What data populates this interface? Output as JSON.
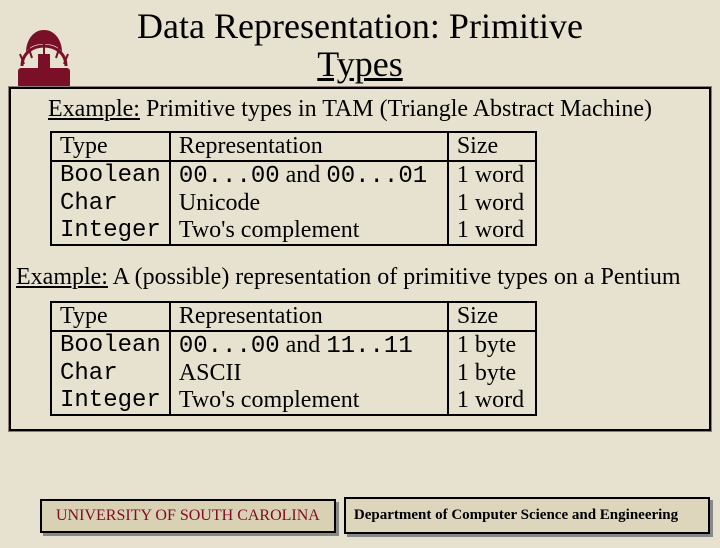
{
  "title_line1": "Data Representation: Primitive",
  "title_line2": "Types",
  "example1_label": "Example:",
  "example1_text": " Primitive types in TAM (Triangle Abstract Machine)",
  "table1": {
    "headers": [
      "Type",
      "Representation",
      "Size"
    ],
    "rows": [
      {
        "type": "Boolean",
        "repr_parts": [
          "00...00",
          " and ",
          "00...01"
        ],
        "size": "1 word"
      },
      {
        "type": "Char",
        "repr_parts": [
          "Unicode"
        ],
        "size": "1 word"
      },
      {
        "type": "Integer",
        "repr_parts": [
          "Two's complement"
        ],
        "size": "1 word"
      }
    ]
  },
  "example2_label": "Example:",
  "example2_text": " A (possible) representation of primitive types on a Pentium",
  "table2": {
    "headers": [
      "Type",
      "Representation",
      "Size"
    ],
    "rows": [
      {
        "type": "Boolean",
        "repr_parts": [
          "00...00",
          " and ",
          "11..11"
        ],
        "size": "1 byte"
      },
      {
        "type": "Char",
        "repr_parts": [
          "ASCII"
        ],
        "size": "1 byte"
      },
      {
        "type": "Integer",
        "repr_parts": [
          "Two's complement"
        ],
        "size": "1 word"
      }
    ]
  },
  "footer_left": "UNIVERSITY OF SOUTH CAROLINA",
  "footer_right": "Department of Computer Science and Engineering"
}
